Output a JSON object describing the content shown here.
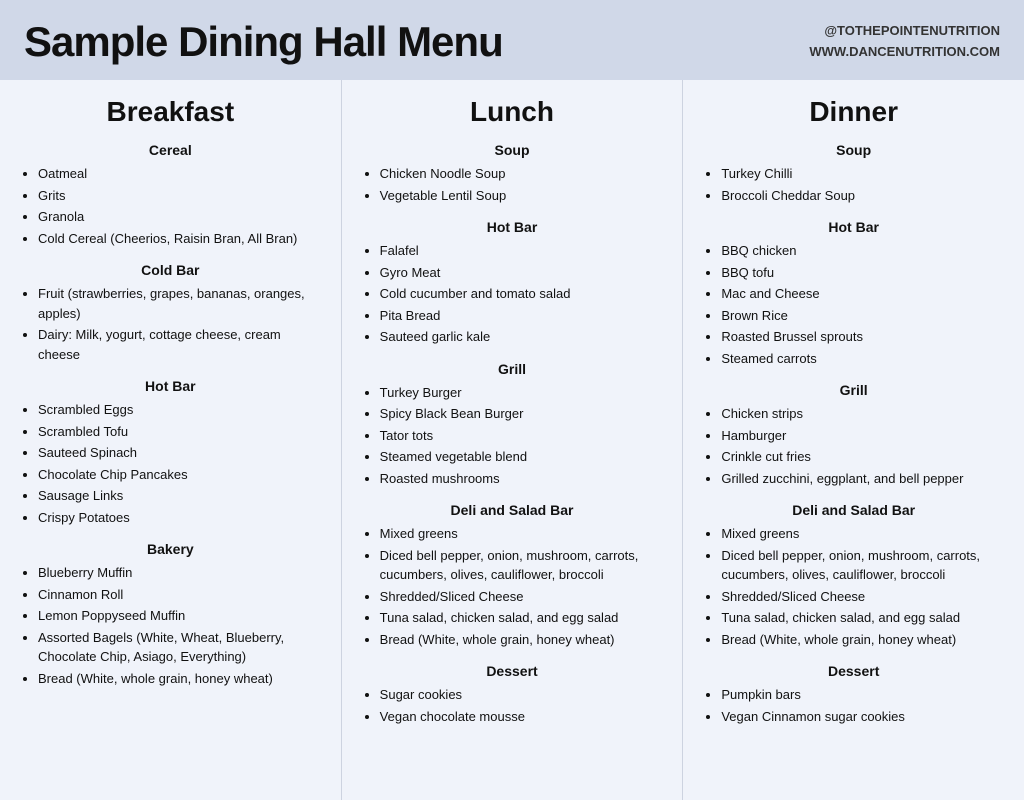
{
  "header": {
    "title": "Sample Dining Hall Menu",
    "handle": "@TOTHEPOINTENUTRITION",
    "website": "WWW.DANCENUTRITION.COM"
  },
  "breakfast": {
    "title": "Breakfast",
    "sections": [
      {
        "name": "Cereal",
        "items": [
          "Oatmeal",
          "Grits",
          "Granola",
          "Cold Cereal (Cheerios, Raisin Bran, All Bran)"
        ]
      },
      {
        "name": "Cold Bar",
        "items": [
          "Fruit (strawberries, grapes, bananas, oranges, apples)",
          "Dairy: Milk, yogurt, cottage cheese, cream cheese"
        ]
      },
      {
        "name": "Hot Bar",
        "items": [
          "Scrambled Eggs",
          "Scrambled Tofu",
          "Sauteed Spinach",
          "Chocolate Chip Pancakes",
          "Sausage Links",
          "Crispy Potatoes"
        ]
      },
      {
        "name": "Bakery",
        "items": [
          "Blueberry Muffin",
          "Cinnamon Roll",
          "Lemon Poppyseed Muffin",
          "Assorted Bagels (White, Wheat, Blueberry, Chocolate Chip, Asiago, Everything)",
          "Bread  (White, whole grain, honey wheat)"
        ]
      }
    ]
  },
  "lunch": {
    "title": "Lunch",
    "sections": [
      {
        "name": "Soup",
        "items": [
          "Chicken Noodle Soup",
          "Vegetable Lentil Soup"
        ]
      },
      {
        "name": "Hot Bar",
        "items": [
          "Falafel",
          "Gyro Meat",
          "Cold cucumber and tomato salad",
          "Pita Bread",
          "Sauteed garlic kale"
        ]
      },
      {
        "name": "Grill",
        "items": [
          "Turkey Burger",
          "Spicy Black Bean Burger",
          "Tator tots",
          "Steamed vegetable blend",
          "Roasted mushrooms"
        ]
      },
      {
        "name": "Deli and Salad Bar",
        "items": [
          "Mixed greens",
          "Diced bell pepper, onion, mushroom, carrots, cucumbers, olives, cauliflower, broccoli",
          "Shredded/Sliced Cheese",
          "Tuna salad, chicken salad, and egg salad",
          "Bread (White, whole grain, honey wheat)"
        ]
      },
      {
        "name": "Dessert",
        "items": [
          "Sugar cookies",
          "Vegan chocolate mousse"
        ]
      }
    ]
  },
  "dinner": {
    "title": "Dinner",
    "sections": [
      {
        "name": "Soup",
        "items": [
          "Turkey Chilli",
          "Broccoli Cheddar Soup"
        ]
      },
      {
        "name": "Hot Bar",
        "items": [
          "BBQ chicken",
          "BBQ tofu",
          "Mac and Cheese",
          "Brown Rice",
          "Roasted Brussel sprouts",
          "Steamed carrots"
        ]
      },
      {
        "name": "Grill",
        "items": [
          "Chicken strips",
          "Hamburger",
          "Crinkle cut fries",
          "Grilled zucchini, eggplant, and bell pepper"
        ]
      },
      {
        "name": "Deli and Salad Bar",
        "items": [
          "Mixed greens",
          "Diced bell pepper, onion, mushroom, carrots, cucumbers, olives, cauliflower, broccoli",
          "Shredded/Sliced Cheese",
          "Tuna salad, chicken salad, and egg salad",
          "Bread (White, whole grain, honey wheat)"
        ]
      },
      {
        "name": "Dessert",
        "items": [
          "Pumpkin bars",
          "Vegan Cinnamon sugar cookies"
        ]
      }
    ]
  }
}
